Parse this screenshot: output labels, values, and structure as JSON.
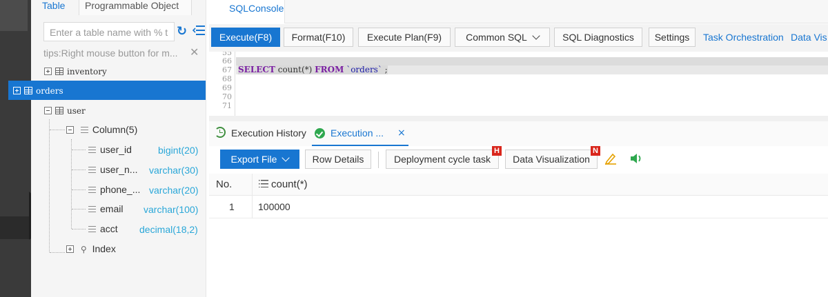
{
  "left_panel": {
    "tabs": [
      {
        "label": "Table",
        "active": true
      },
      {
        "label": "Programmable Object",
        "active": false
      }
    ],
    "search_placeholder": "Enter a table name with % t",
    "tips": "tips:Right mouse button for m...",
    "tree": {
      "inventory": "inventory",
      "orders": "orders",
      "user": "user",
      "column_group": "Column(5)",
      "columns": [
        {
          "name": "user_id",
          "type": "bigint(20)"
        },
        {
          "name": "user_n...",
          "type": "varchar(30)"
        },
        {
          "name": "phone_...",
          "type": "varchar(20)"
        },
        {
          "name": "email",
          "type": "varchar(100)"
        },
        {
          "name": "acct",
          "type": "decimal(18,2)"
        }
      ],
      "index": "Index"
    }
  },
  "top_tab": "SQLConsole",
  "toolbar": {
    "execute": "Execute(F8)",
    "format": "Format(F10)",
    "plan": "Execute Plan(F9)",
    "common_sql": "Common SQL",
    "diagnostics": "SQL Diagnostics",
    "settings": "Settings",
    "task_orchestration": "Task Orchestration",
    "data_vis": "Data Vis"
  },
  "editor": {
    "line_numbers": [
      "66",
      "67",
      "68",
      "69",
      "70",
      "71"
    ],
    "code": {
      "kw1": "SELECT",
      "fn": "count(*)",
      "kw2": "FROM",
      "tbl": "`orders`",
      "end": ";"
    }
  },
  "result_tabs": {
    "history": "Execution History",
    "execution": "Execution ...",
    "close": "×"
  },
  "result_toolbar": {
    "export": "Export File",
    "row_details": "Row Details",
    "deployment": "Deployment cycle task",
    "deployment_badge": "H",
    "data_visualization": "Data Visualization",
    "data_vis_badge": "N"
  },
  "grid": {
    "headers": [
      "No.",
      "count(*)"
    ],
    "rows": [
      [
        "1",
        "100000"
      ]
    ]
  },
  "colors": {
    "accent": "#1876d1",
    "type_color": "#2aa7d8",
    "keyword": "#7a1fa2",
    "badge": "#d9261c",
    "success": "#2fa84f"
  }
}
